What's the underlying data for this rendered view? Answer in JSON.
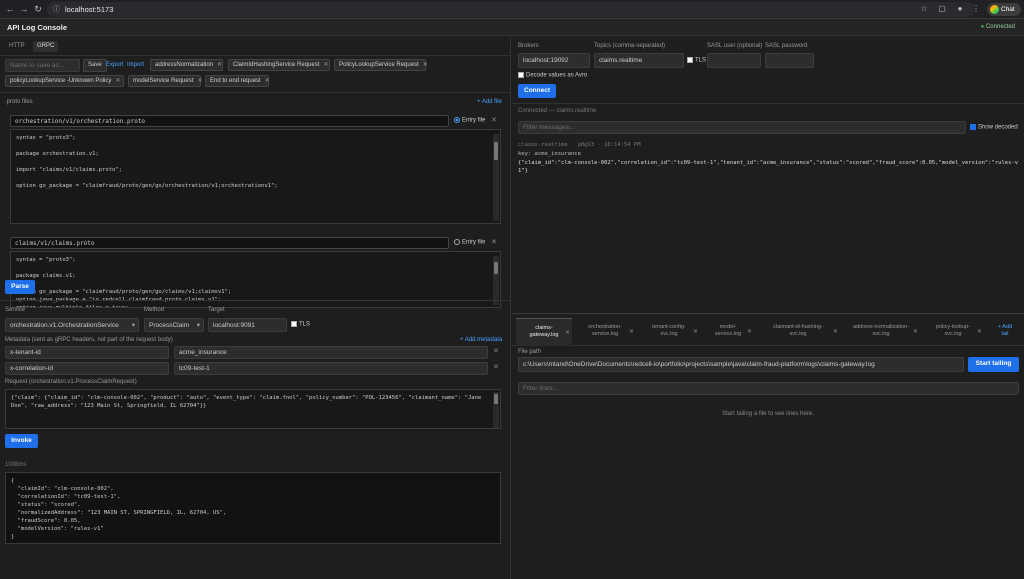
{
  "browser": {
    "url": "localhost:5173",
    "chat_label": "Chat"
  },
  "app": {
    "title": "API Log Console",
    "status": "Connected",
    "status_color": "#4caf50"
  },
  "left": {
    "tabs": [
      "HTTP",
      "GRPC"
    ],
    "selected_tab": "GRPC",
    "save_placeholder": "Name to save as...",
    "save_label": "Save",
    "export_label": "Export",
    "import_label": "Import",
    "saved_requests": [
      "addressNormalization",
      "ClaimIdHashingService Request",
      "PolicyLookupService Request",
      "policyLookupService -Unknown Policy",
      "modelService Request",
      "End to end request"
    ],
    "proto_section_label": ".proto files",
    "add_file_label": "+ Add file",
    "entry_file_label": "Entry file",
    "proto_files": [
      {
        "name": "orchestration/v1/orchestration.proto",
        "entry": true,
        "content": "syntax = \"proto3\";\n\npackage orchestration.v1;\n\nimport \"claims/v1/claims.proto\";\n\noption go_package = \"claimfraud/proto/gen/go/orchestration/v1;orchestrationv1\";"
      },
      {
        "name": "claims/v1/claims.proto",
        "entry": false,
        "content": "syntax = \"proto3\";\n\npackage claims.v1;\n\noption go_package = \"claimfraud/proto/gen/go/claims/v1;claimsv1\";\noption java_package = \"io.redcell.claimfraud.proto.claims.v1\";\noption java_multiple_files = true;"
      }
    ],
    "parse_label": "Parse",
    "service_label": "Service",
    "service_value": "orchestration.v1.OrchestrationService",
    "method_label": "Method",
    "method_value": "ProcessClaim",
    "target_label": "Target",
    "target_value": "localhost:9091",
    "tls_label": "TLS",
    "metadata_label": "Metadata (sent as gRPC headers, not part of the request body)",
    "add_metadata_label": "+ Add metadata",
    "metadata": [
      {
        "key": "x-tenant-id",
        "value": "acme_insurance"
      },
      {
        "key": "x-correlation-id",
        "value": "tc09-test-1"
      }
    ],
    "request_label": "Request (orchestration.v1.ProcessClaimRequest)",
    "request_body": "{\"claim\": {\"claim_id\": \"clm-console-002\", \"product\": \"auto\", \"event_type\": \"claim.fnol\", \"policy_number\": \"POL-123456\", \"claimant_name\": \"Jane\nDoe\", \"raw_address\": \"123 Main St, Springfield, IL 62704\"}}",
    "invoke_label": "Invoke",
    "timing": "1008ms",
    "response": "{\n  \"claimId\": \"clm-console-002\",\n  \"correlationId\": \"tc09-test-1\",\n  \"status\": \"scored\",\n  \"normalizedAddress\": \"123 MAIN ST, SPRINGFIELD, IL, 62704, US\",\n  \"fraudScore\": 0.05,\n  \"modelVersion\": \"rules-v1\"\n}"
  },
  "kafka": {
    "brokers_label": "Brokers",
    "brokers_value": "localhost:19092",
    "topics_label": "Topics (comma-separated)",
    "topics_value": "claims.realtime",
    "tls_label": "TLS",
    "sasl_user_label": "SASL user (optional)",
    "sasl_pass_label": "SASL password",
    "avro_label": "Decode values as Avro",
    "connect_label": "Connect",
    "connected_text": "Connected — claims.realtime",
    "filter_placeholder": "Filter messages...",
    "show_decoded_label": "Show decoded",
    "message_meta": "claims.realtime · p0@13 · 10:14:54 PM",
    "message_key": "key: acme_insurance",
    "message_value": "{\"claim_id\":\"clm-console-002\",\"correlation_id\":\"tc09-test-1\",\"tenant_id\":\"acme_insurance\",\"status\":\"scored\",\"fraud_score\":0.05,\"model_version\":\"rules-v\n1\"}"
  },
  "logs": {
    "tabs": [
      {
        "line1": "claims-",
        "line2": "gateway.log"
      },
      {
        "line1": "orchestration-",
        "line2": "service.log"
      },
      {
        "line1": "tenant-config-",
        "line2": "svc.log"
      },
      {
        "line1": "model-",
        "line2": "service.log"
      },
      {
        "line1": "claimant-id-hashing-",
        "line2": "svc.log"
      },
      {
        "line1": "address-normalization-",
        "line2": "svc.log"
      },
      {
        "line1": "policy-lookup-",
        "line2": "svc.log"
      }
    ],
    "add_tail_line1": "+ Add",
    "add_tail_line2": "tail",
    "file_path_label": "File path",
    "file_path_value": "c:\\Users\\mtand\\OneDrive\\Documents\\redcell-io\\portfolio\\projects\\sample\\java\\claim-fraud-platform\\logs\\claims-gateway.log",
    "start_label": "Start tailing",
    "filter_placeholder": "Filter lines...",
    "empty_text": "Start tailing a file to see lines here."
  }
}
